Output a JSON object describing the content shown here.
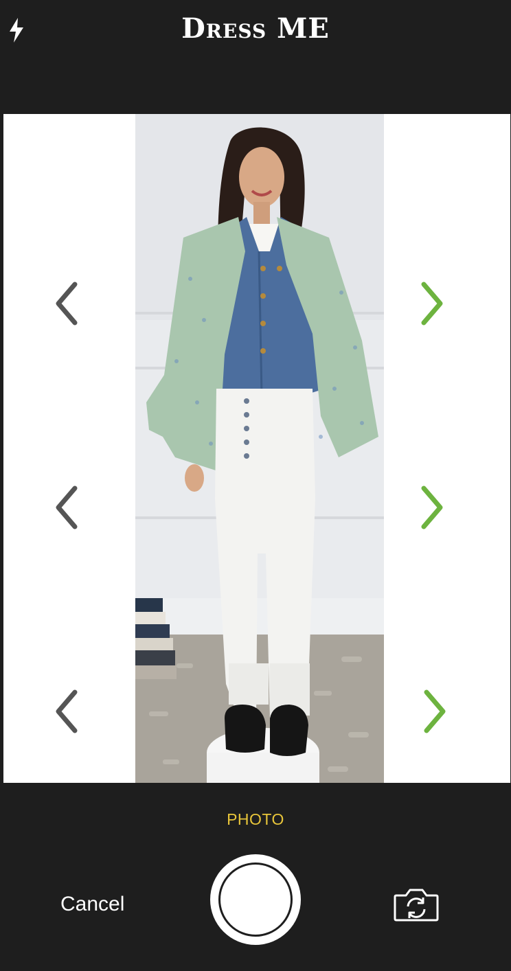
{
  "header": {
    "title": "Dress ME",
    "flash_icon": "flash-icon"
  },
  "viewfinder": {
    "left_arrows": [
      "chevron-left-icon",
      "chevron-left-icon",
      "chevron-left-icon"
    ],
    "right_arrows": [
      "chevron-right-icon",
      "chevron-right-icon",
      "chevron-right-icon"
    ],
    "colors": {
      "left_arrow": "#555555",
      "right_arrow": "#6db33f"
    }
  },
  "footer": {
    "mode_label": "PHOTO",
    "cancel_label": "Cancel",
    "shutter_icon": "shutter-button",
    "flip_icon": "camera-flip-icon"
  },
  "colors": {
    "background": "#1e1e1e",
    "mode_accent": "#e8c53a"
  }
}
